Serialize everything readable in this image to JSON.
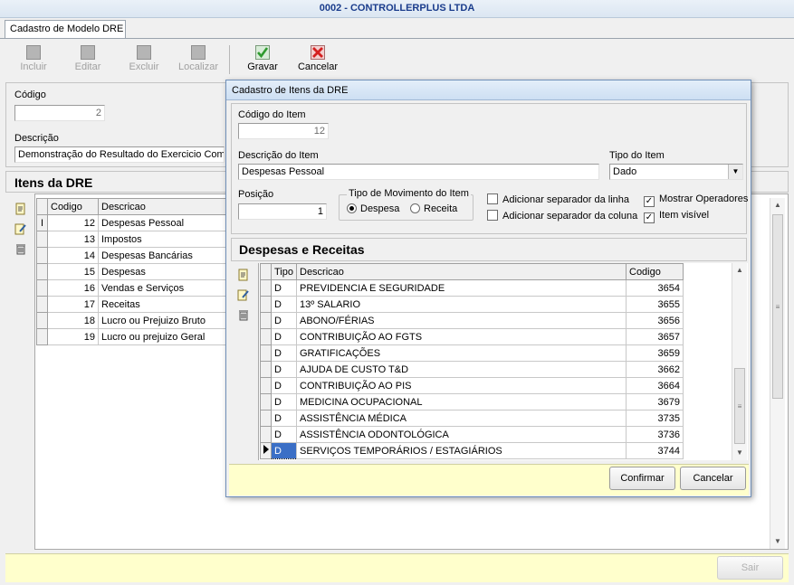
{
  "window": {
    "title": "0002 - CONTROLLERPLUS LTDA"
  },
  "tab": {
    "label": "Cadastro de Modelo DRE"
  },
  "toolbar": {
    "incluir": "Incluir",
    "editar": "Editar",
    "excluir": "Excluir",
    "localizar": "Localizar",
    "gravar": "Gravar",
    "cancelar": "Cancelar"
  },
  "form": {
    "codigo_label": "Código",
    "codigo_value": "2",
    "descricao_label": "Descrição",
    "descricao_value": "Demonstração do Resultado do Exercicio Comp"
  },
  "itens": {
    "title": "Itens da DRE",
    "columns": {
      "codigo": "Codigo",
      "descricao": "Descricao"
    },
    "row_marker": "I",
    "rows": [
      {
        "codigo": "12",
        "descricao": "Despesas Pessoal"
      },
      {
        "codigo": "13",
        "descricao": "Impostos"
      },
      {
        "codigo": "14",
        "descricao": "Despesas Bancárias"
      },
      {
        "codigo": "15",
        "descricao": "Despesas"
      },
      {
        "codigo": "16",
        "descricao": "Vendas e Serviços"
      },
      {
        "codigo": "17",
        "descricao": "Receitas"
      },
      {
        "codigo": "18",
        "descricao": "Lucro ou Prejuizo Bruto"
      },
      {
        "codigo": "19",
        "descricao": "Lucro ou prejuizo Geral"
      }
    ]
  },
  "footer": {
    "sair": "Sair"
  },
  "dialog": {
    "title": "Cadastro de Itens da DRE",
    "codigo_label": "Código do Item",
    "codigo_value": "12",
    "descricao_label": "Descrição do Item",
    "descricao_value": "Despesas Pessoal",
    "tipo_label": "Tipo do Item",
    "tipo_value": "Dado",
    "posicao_label": "Posição",
    "posicao_value": "1",
    "movimento_label": "Tipo de Movimento do Item",
    "despesa_label": "Despesa",
    "receita_label": "Receita",
    "chk_sep_linha": "Adicionar separador da linha",
    "chk_sep_coluna": "Adicionar separador da coluna",
    "chk_operadores": "Mostrar Operadores",
    "chk_visivel": "Item visível",
    "section_title": "Despesas e Receitas",
    "columns": {
      "tipo": "Tipo",
      "descricao": "Descricao",
      "codigo": "Codigo"
    },
    "rows": [
      {
        "tipo": "D",
        "descricao": "PREVIDENCIA E SEGURIDADE",
        "codigo": "3654"
      },
      {
        "tipo": "D",
        "descricao": "13º SALARIO",
        "codigo": "3655"
      },
      {
        "tipo": "D",
        "descricao": "ABONO/FÉRIAS",
        "codigo": "3656"
      },
      {
        "tipo": "D",
        "descricao": "CONTRIBUIÇÃO AO FGTS",
        "codigo": "3657"
      },
      {
        "tipo": "D",
        "descricao": "GRATIFICAÇÕES",
        "codigo": "3659"
      },
      {
        "tipo": "D",
        "descricao": "AJUDA DE CUSTO T&D",
        "codigo": "3662"
      },
      {
        "tipo": "D",
        "descricao": "CONTRIBUIÇÃO AO PIS",
        "codigo": "3664"
      },
      {
        "tipo": "D",
        "descricao": "MEDICINA OCUPACIONAL",
        "codigo": "3679"
      },
      {
        "tipo": "D",
        "descricao": "ASSISTÊNCIA MÉDICA",
        "codigo": "3735"
      },
      {
        "tipo": "D",
        "descricao": "ASSISTÊNCIA ODONTOLÓGICA",
        "codigo": "3736"
      },
      {
        "tipo": "D",
        "descricao": "SERVIÇOS TEMPORÁRIOS / ESTAGIÁRIOS",
        "codigo": "3744"
      }
    ],
    "confirmar": "Confirmar",
    "cancelar": "Cancelar"
  },
  "colors": {
    "footer_bg": "#ffffcc",
    "title_text": "#1a3c8c",
    "gravar_icon": "#2e9a2e",
    "cancelar_icon": "#d42020"
  }
}
